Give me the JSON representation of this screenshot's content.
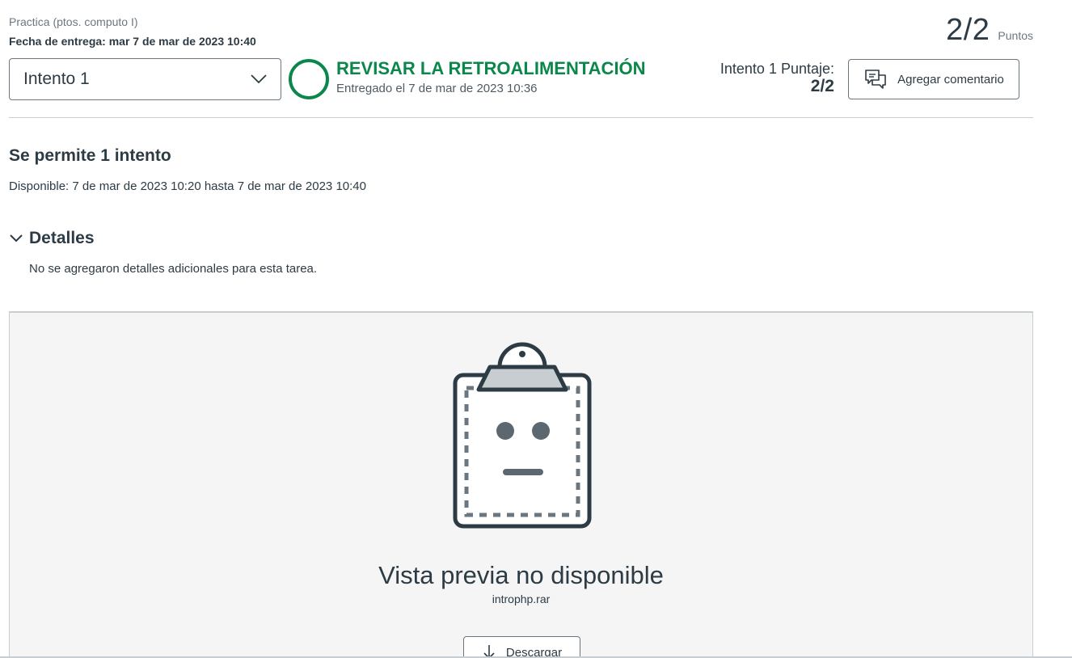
{
  "header": {
    "assignment_name": "Practica (ptos. computo I)",
    "due_date": "Fecha de entrega: mar 7 de mar de 2023 10:40",
    "points_value": "2/2",
    "points_label": "Puntos"
  },
  "attempt_select": {
    "selected": "Intento 1",
    "icon": "chevron-down-icon"
  },
  "status": {
    "title": "REVISAR LA RETROALIMENTACIÓN",
    "submitted": "Entregado el 7 de mar de 2023 10:36",
    "color": "#0b874b"
  },
  "score": {
    "label": "Intento 1 Puntaje:",
    "value": "2/2"
  },
  "comment_button": {
    "label": "Agregar comentario",
    "icon": "comments-icon"
  },
  "info": {
    "attempts_allowed": "Se permite 1 intento",
    "availability": "Disponible: 7 de mar de 2023 10:20 hasta 7 de mar de 2023 10:40"
  },
  "details": {
    "title": "Detalles",
    "body": "No se agregaron detalles adicionales para esta tarea.",
    "icon": "chevron-down-icon"
  },
  "preview": {
    "title": "Vista previa no disponible",
    "filename": "introphp.rar",
    "illustration": "clipboard-face-icon",
    "download_label": "Descargar",
    "download_icon": "download-icon"
  }
}
